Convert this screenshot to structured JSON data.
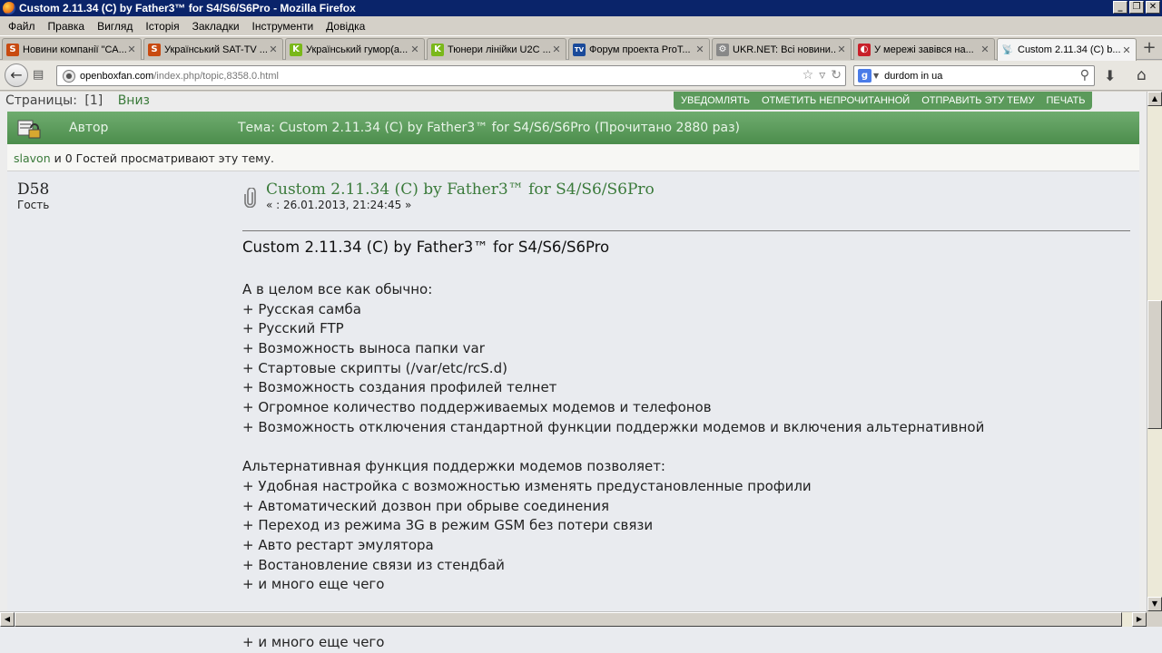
{
  "window": {
    "title": "Custom 2.11.34 (C) by Father3™ for S4/S6/S6Pro - Mozilla Firefox",
    "minimize": "_",
    "restore": "❐",
    "close": "✕"
  },
  "menu": [
    "Файл",
    "Правка",
    "Вигляд",
    "Історія",
    "Закладки",
    "Інструменти",
    "Довідка"
  ],
  "tabs": [
    {
      "label": "Новини компанії \"СА...",
      "favicon": "S",
      "favicon_color": "#c84a10"
    },
    {
      "label": "Український SAT-TV ...",
      "favicon": "S",
      "favicon_color": "#c84a10"
    },
    {
      "label": "Український гумор(а...",
      "favicon": "K",
      "favicon_color": "#7ab81a"
    },
    {
      "label": "Тюнери лінійки U2C ...",
      "favicon": "K",
      "favicon_color": "#7ab81a"
    },
    {
      "label": "Форум проекта ProT...",
      "favicon": "TV",
      "favicon_color": "#1a4a9a"
    },
    {
      "label": "UKR.NET: Всі новини...",
      "favicon": "⚙",
      "favicon_color": "#666666"
    },
    {
      "label": "У мережі завівся на...",
      "favicon": "◐",
      "favicon_color": "#c8202a"
    },
    {
      "label": "Custom 2.11.34 (C) b...",
      "favicon": "📡",
      "favicon_color": "#2a6ab8"
    }
  ],
  "tab_close": "✕",
  "new_tab": "+",
  "nav": {
    "back": "←",
    "url_host": "openboxfan.com",
    "url_path": "/index.php/topic,8358.0.html",
    "search_value": "durdom in ua",
    "search_engine": "g"
  },
  "page": {
    "pager_label": "Страницы:",
    "pager_current": "[1]",
    "pager_down": "Вниз",
    "actions": [
      "УВЕДОМЛЯТЬ",
      "ОТМЕТИТЬ НЕПРОЧИТАННОЙ",
      "ОТПРАВИТЬ ЭТУ ТЕМУ",
      "ПЕЧАТЬ"
    ],
    "header_author": "Автор",
    "header_topic": "Тема: Custom 2.11.34 (C) by Father3™ for S4/S6/S6Pro  (Прочитано 2880 раз)",
    "viewers_user": "slavon",
    "viewers_rest": " и 0 Гостей просматривают эту тему.",
    "post": {
      "poster_name": "D58",
      "poster_group": "Гость",
      "title": "Custom 2.11.34 (C) by Father3™ for S4/S6/S6Pro",
      "date": "« : 26.01.2013, 21:24:45 »",
      "heading": "Custom 2.11.34 (C) by Father3™ for S4/S6/S6Pro",
      "body_block1": [
        "А в целом все как обычно:",
        "+ Русская самба",
        "+ Русский FTP",
        "+ Возможность выноса папки var",
        "+ Стартовые скрипты (/var/etc/rcS.d)",
        "+ Возможность создания профилей телнет",
        "+ Огромное количество поддерживаемых модемов и телефонов",
        "+ Возможность отключения стандартной функции поддержки модемов и включения альтернативной"
      ],
      "body_block2": [
        "Альтернативная функция поддержки модемов позволяет:",
        "+ Удобная настройка с возможностью изменять предустановленные профили",
        "+ Автоматический дозвон при обрыве соединения",
        "+ Переход из режима 3G в режим GSM без потери связи",
        "+ Авто рестарт эмулятора",
        "+ Востановление связи из стендбай",
        "+ и много еще чего"
      ]
    },
    "ghost_line": "+ и много еще чего"
  }
}
